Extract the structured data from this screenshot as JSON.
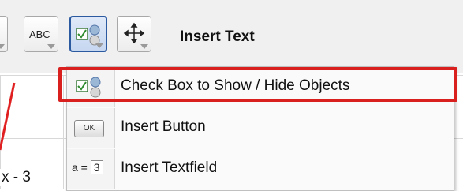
{
  "toolbar": {
    "abc_label": "ABC",
    "tool_title": "Insert Text"
  },
  "menu": {
    "items": [
      {
        "label": "Check Box to Show / Hide Objects",
        "icon": "checkbox-show-hide-icon"
      },
      {
        "label": "Insert Button",
        "icon": "button-ok-icon",
        "icon_text": "OK"
      },
      {
        "label": "Insert Textfield",
        "icon": "textfield-icon",
        "icon_text": "a = 3"
      }
    ]
  },
  "canvas": {
    "expression": "x - 3"
  },
  "colors": {
    "highlight": "#d9201f",
    "curve": "#e02020",
    "active_border": "#2c5aa0"
  }
}
